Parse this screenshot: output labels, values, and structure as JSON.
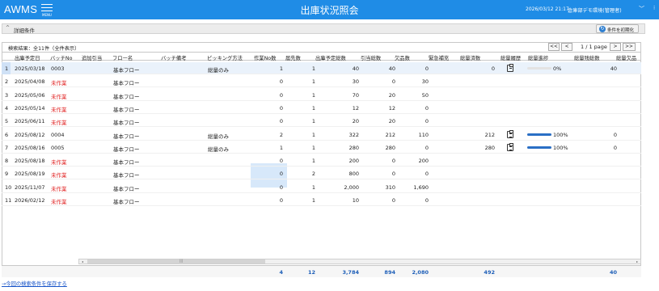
{
  "header": {
    "logo": "AWMS",
    "menu_label": "MENU",
    "title": "出庫状況照会",
    "datetime": "2026/03/12 21:17",
    "user": "倉庫部デモ環境(管理者)",
    "caret": "﹀",
    "caret2": "⁝"
  },
  "conditions": {
    "chevron": "^",
    "label": "詳細条件",
    "reset_button": "条件を初期化",
    "reset_icon": "refresh-icon"
  },
  "results": {
    "info": "検索結果：全11件（全件表示）",
    "pager": {
      "first": "<<",
      "prev": "<",
      "page_label": "1 / 1 page",
      "next": ">",
      "last": ">>"
    }
  },
  "columns": [
    "出庫予定日",
    "バッチNo",
    "追加引当",
    "フロー名",
    "バッチ備考",
    "ピッキング方法",
    "作業No数",
    "届先数",
    "出庫予定総数",
    "引当総数",
    "欠品数",
    "緊急補充",
    "総量済数",
    "総量履歴",
    "総量進捗",
    "総量残総数",
    "総量欠品"
  ],
  "rows": [
    {
      "no": "1",
      "date": "2025/03/18",
      "batch": "0003",
      "flow": "基本フロー",
      "picking": "総量のみ",
      "work": "1",
      "dest": "1",
      "planned": "40",
      "alloc": "40",
      "short": "0",
      "done": "0",
      "has_history": true,
      "progress_label": "0%",
      "progress": 0,
      "remain": "40"
    },
    {
      "no": "2",
      "date": "2025/04/08",
      "batch": "未作業",
      "flow": "基本フロー",
      "picking": "",
      "work": "0",
      "dest": "1",
      "planned": "30",
      "alloc": "0",
      "short": "30",
      "done": "",
      "has_history": false,
      "progress_label": "",
      "remain": ""
    },
    {
      "no": "3",
      "date": "2025/05/06",
      "batch": "未作業",
      "flow": "基本フロー",
      "picking": "",
      "work": "0",
      "dest": "1",
      "planned": "70",
      "alloc": "20",
      "short": "50",
      "done": "",
      "has_history": false,
      "progress_label": "",
      "remain": ""
    },
    {
      "no": "4",
      "date": "2025/05/14",
      "batch": "未作業",
      "flow": "基本フロー",
      "picking": "",
      "work": "0",
      "dest": "1",
      "planned": "12",
      "alloc": "12",
      "short": "0",
      "done": "",
      "has_history": false,
      "progress_label": "",
      "remain": ""
    },
    {
      "no": "5",
      "date": "2025/06/11",
      "batch": "未作業",
      "flow": "基本フロー",
      "picking": "",
      "work": "0",
      "dest": "1",
      "planned": "20",
      "alloc": "20",
      "short": "0",
      "done": "",
      "has_history": false,
      "progress_label": "",
      "remain": ""
    },
    {
      "no": "6",
      "date": "2025/08/12",
      "batch": "0004",
      "flow": "基本フロー",
      "picking": "総量のみ",
      "work": "2",
      "dest": "1",
      "planned": "322",
      "alloc": "212",
      "short": "110",
      "done": "212",
      "has_history": true,
      "progress_label": "100%",
      "progress": 100,
      "remain": "0"
    },
    {
      "no": "7",
      "date": "2025/08/16",
      "batch": "0005",
      "flow": "基本フロー",
      "picking": "総量のみ",
      "work": "1",
      "dest": "1",
      "planned": "280",
      "alloc": "280",
      "short": "0",
      "done": "280",
      "has_history": true,
      "progress_label": "100%",
      "progress": 100,
      "remain": "0"
    },
    {
      "no": "8",
      "date": "2025/08/18",
      "batch": "未作業",
      "flow": "基本フロー",
      "picking": "",
      "work": "0",
      "dest": "1",
      "planned": "200",
      "alloc": "0",
      "short": "200",
      "done": "",
      "has_history": false,
      "progress_label": "",
      "remain": ""
    },
    {
      "no": "9",
      "date": "2025/08/19",
      "batch": "未作業",
      "flow": "基本フロー",
      "picking": "",
      "work": "0",
      "dest": "2",
      "planned": "800",
      "alloc": "0",
      "short": "0",
      "done": "",
      "has_history": false,
      "progress_label": "",
      "remain": ""
    },
    {
      "no": "10",
      "date": "2025/11/07",
      "batch": "未作業",
      "flow": "基本フロー",
      "picking": "",
      "work": "0",
      "dest": "1",
      "planned": "2,000",
      "alloc": "310",
      "short": "1,690",
      "done": "",
      "has_history": false,
      "progress_label": "",
      "remain": ""
    },
    {
      "no": "11",
      "date": "2026/02/12",
      "batch": "未作業",
      "flow": "基本フロー",
      "picking": "",
      "work": "0",
      "dest": "1",
      "planned": "10",
      "alloc": "0",
      "short": "0",
      "done": "",
      "has_history": false,
      "progress_label": "",
      "remain": ""
    }
  ],
  "totals": {
    "work": "4",
    "dest": "12",
    "planned": "3,784",
    "alloc": "894",
    "short": "2,080",
    "done": "492",
    "remain": "40"
  },
  "scrollbar": {
    "left_arrow": "◂",
    "right_arrow": "▸",
    "grip": "|||"
  },
  "save_link": "→今回の検索条件を保存する",
  "colors": {
    "header_bg": "#1f8ce6",
    "not_started": "#e02020",
    "totals": "#1e5fb8",
    "progress": "#2a6fc5"
  }
}
